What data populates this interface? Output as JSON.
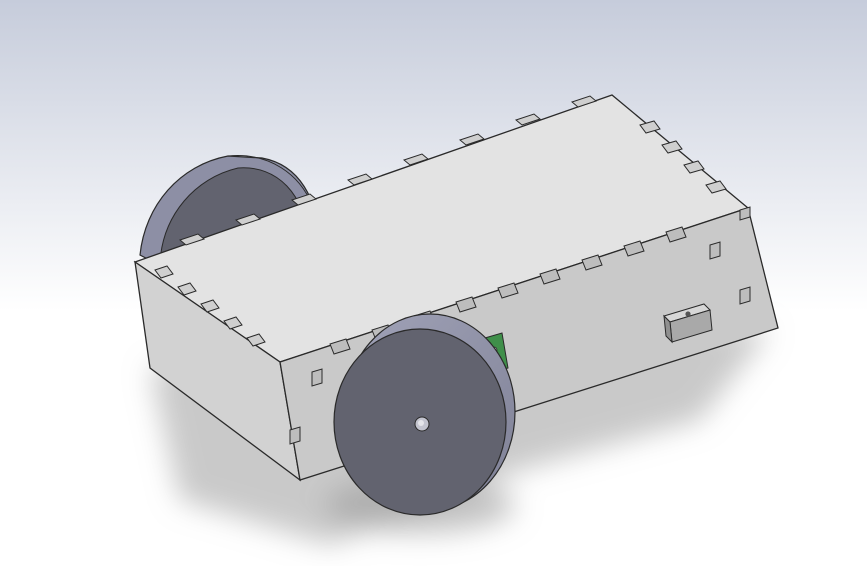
{
  "viewport": {
    "background_top": "#c6ccdb",
    "background_bottom": "#ffffff"
  },
  "model": {
    "part_light": "#e3e3e3",
    "part_mid": "#d2d2d2",
    "part_dark": "#bdbdbd",
    "edge": "#2a2a2a",
    "wheel_face": "#62636f",
    "wheel_tread": "#8d8fa5",
    "wheel_rim": "#6d6e7c",
    "board": "#3f8f4a",
    "shadow": "#9c9c9c",
    "icons": [
      "box-chassis-icon",
      "wheel-icon",
      "sensor-block-icon",
      "circuit-board-icon"
    ]
  }
}
